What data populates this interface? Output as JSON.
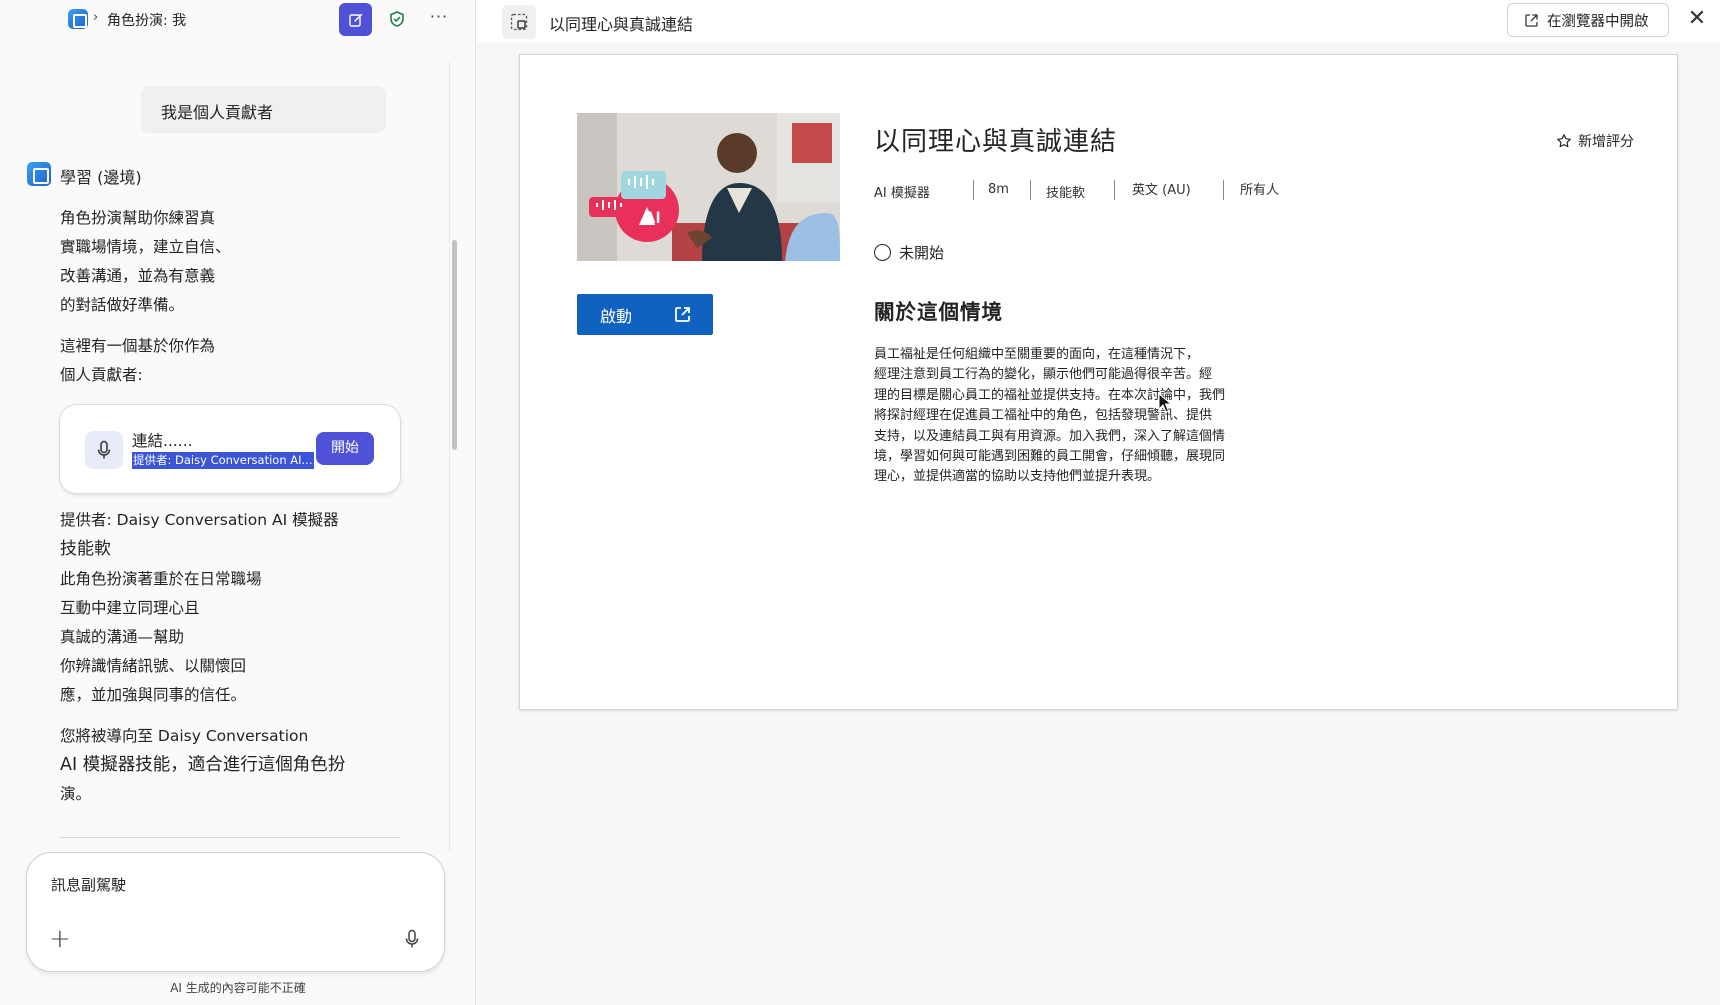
{
  "left_panel": {
    "breadcrumb_title": "角色扮演: 我",
    "user_message": "我是個人貢獻者",
    "bot_name": "學習 (邊境)",
    "intro_paragraph": [
      "角色扮演幫助你練習真",
      "實職場情境，建立自信、",
      "改善溝通，並為有意義",
      "的對話做好準備。"
    ],
    "lead_paragraph": [
      "這裡有一個基於你作為",
      "個人貢獻者:"
    ],
    "card": {
      "title": "連結......",
      "subtitle": "提供者: Daisy Conversation AI...",
      "start_button": "開始"
    },
    "provider_line": "提供者: Daisy Conversation AI 模擬器",
    "skill_line": "技能軟",
    "description_paragraph": [
      "此角色扮演著重於在日常職場",
      "互動中建立同理心且",
      "真誠的溝通—幫助",
      "你辨識情緒訊號、以關懷回",
      "應，並加強與同事的信任。"
    ],
    "redirect_paragraph": [
      "您將被導向至 Daisy Conversation",
      "AI 模擬器技能，適合進行這個角色扮",
      "演。"
    ],
    "composer_placeholder": "訊息副駕駛",
    "disclaimer": "AI 生成的內容可能不正確"
  },
  "right_panel": {
    "header_title": "以同理心與真誠連結",
    "open_in_browser": "在瀏覽器中開啟",
    "course": {
      "title": "以同理心與真誠連結",
      "add_rating": "新增評分",
      "meta": [
        "AI 模擬器",
        "8m",
        "技能軟",
        "英文 (AU)",
        "所有人"
      ],
      "status": "未開始",
      "launch_button": "啟動",
      "hero_badge": "AI",
      "about_heading": "關於這個情境",
      "about_lines": [
        "員工福祉是任何組織中至關重要的面向，在這種情況下，",
        "經理注意到員工行為的變化，顯示他們可能過得很辛苦。經",
        "理的目標是關心員工的福祉並提供支持。在本次討論中，我們",
        "將探討經理在促進員工福祉中的角色，包括發現警訊、提供",
        "支持，以及連結員工與有用資源。加入我們，深入了解這個情",
        "境，學習如何與可能遇到困難的員工開會，仔細傾聽，展現同",
        "理心，並提供適當的協助以支持他們並提升表現。"
      ]
    }
  },
  "colors": {
    "accent": "#4f52d6",
    "launch_blue": "#0f62c0",
    "highlight": "#3b55d6",
    "hero_pink": "#e8305b"
  },
  "icons": [
    "app-logo-icon",
    "chevron-right-icon",
    "new-chat-icon",
    "shield-check-icon",
    "more-icon",
    "bot-avatar-icon",
    "mic-icon",
    "plus-icon",
    "panel-icon",
    "open-external-icon",
    "close-icon",
    "star-icon",
    "status-circle-icon",
    "cursor-icon"
  ]
}
